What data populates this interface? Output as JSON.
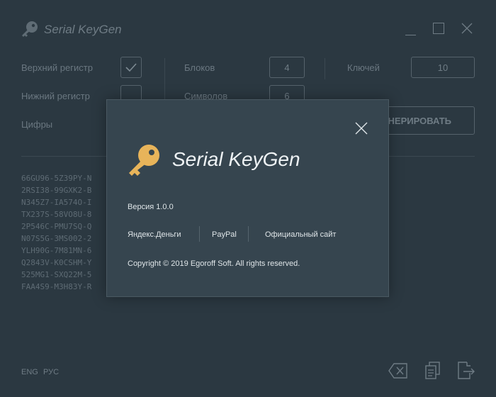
{
  "window": {
    "title": "Serial KeyGen",
    "controls": [
      "minimize",
      "maximize",
      "close"
    ]
  },
  "options": {
    "uppercase_label": "Верхний регистр",
    "uppercase_checked": true,
    "lowercase_label": "Нижний регистр",
    "lowercase_checked": false,
    "digits_label": "Цифры",
    "blocks_label": "Блоков",
    "blocks_value": "4",
    "symbols_label": "Символов",
    "symbols_value": "6",
    "keys_label": "Ключей",
    "keys_value": "10",
    "generate_label": "НЕРИРОВАТЬ"
  },
  "keys_list": [
    "66GU96-5Z39PY-N",
    "2RSI38-99GXK2-B",
    "N345Z7-IA574O-I",
    "TX237S-58VO8U-8",
    "2P546C-PMU7SQ-Q",
    "N07S5G-3MS002-2",
    "YLH90G-7M81MN-6",
    "Q2843V-K0CSHM-Y",
    "525MG1-SXQ22M-5",
    "FAA4S9-M3H83Y-R"
  ],
  "footer": {
    "lang_eng": "ENG",
    "lang_rus": "РУС",
    "actions": [
      "clear-icon",
      "copy-icon",
      "export-icon"
    ]
  },
  "about_dialog": {
    "title": "Serial KeyGen",
    "version": "Версия 1.0.0",
    "links": [
      "Яндекс.Деньги",
      "PayPal",
      "Официальный сайт"
    ],
    "copyright": "Copyright © 2019 Egoroff Soft. All rights reserved."
  },
  "colors": {
    "background": "#2b3841",
    "dialog": "#36454f",
    "key_icon": "#e8b45a"
  }
}
